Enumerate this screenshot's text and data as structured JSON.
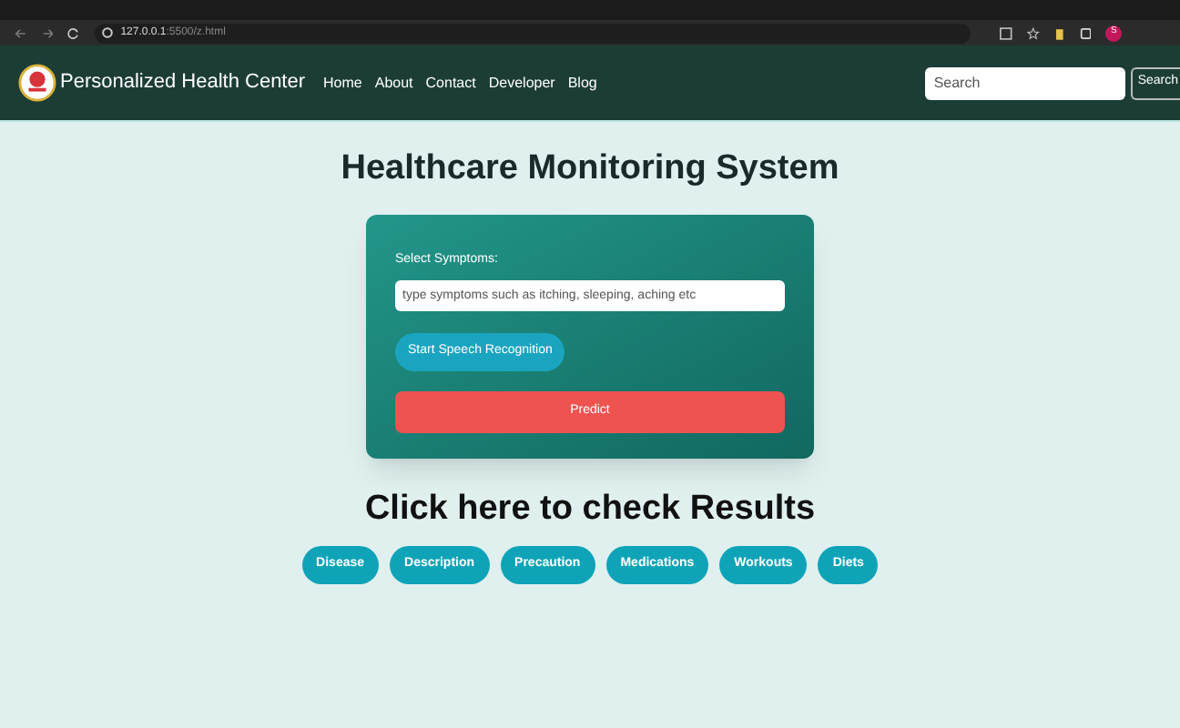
{
  "browser": {
    "url_host": "127.0.0.1",
    "url_path": ":5500/z.html",
    "profile": "S"
  },
  "navbar": {
    "brand": "Personalized Health Center",
    "links": [
      "Home",
      "About",
      "Contact",
      "Developer",
      "Blog"
    ],
    "search": {
      "placeholder": "Search"
    },
    "search_button": "Search"
  },
  "title": "Healthcare Monitoring System",
  "form": {
    "label": "Select Symptoms:",
    "input": {
      "placeholder": "type symptoms such as itching, sleeping, aching etc"
    },
    "speech_button": "Start Speech Recognition",
    "predict_button": "Predict"
  },
  "results": {
    "heading": "Click here to check Results",
    "buttons": [
      "Disease",
      "Description",
      "Precaution",
      "Medications",
      "Workouts",
      "Diets"
    ]
  }
}
